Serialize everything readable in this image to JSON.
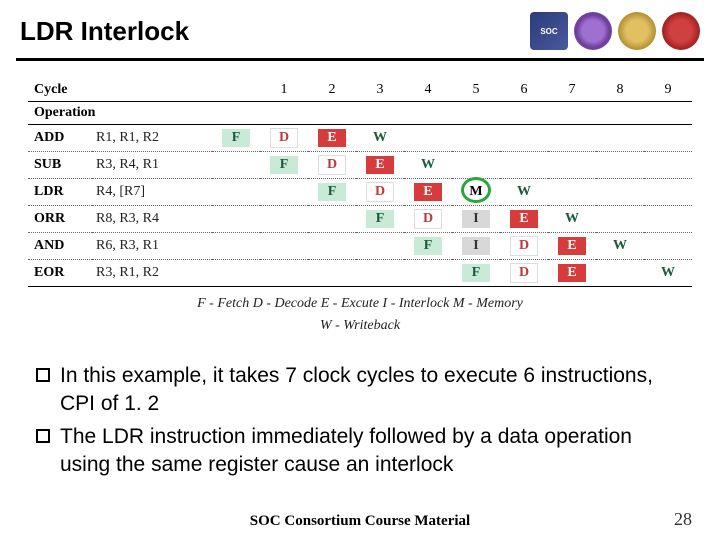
{
  "title": "LDR Interlock",
  "logos": [
    "SOC",
    "",
    "",
    ""
  ],
  "chart_data": {
    "type": "table",
    "title": "Pipeline cycle diagram",
    "header_label_1": "Cycle",
    "header_label_2": "Operation",
    "cycle_columns": [
      "",
      "1",
      "2",
      "3",
      "4",
      "5",
      "6",
      "7",
      "8",
      "9"
    ],
    "rows": [
      {
        "instr": "ADD",
        "operands": "R1, R1, R2",
        "stages": [
          "F",
          "D",
          "E",
          "W",
          "",
          "",
          "",
          "",
          "",
          ""
        ]
      },
      {
        "instr": "SUB",
        "operands": "R3, R4, R1",
        "stages": [
          "",
          "F",
          "D",
          "E",
          "W",
          "",
          "",
          "",
          "",
          ""
        ]
      },
      {
        "instr": "LDR",
        "operands": "R4, [R7]",
        "stages": [
          "",
          "",
          "F",
          "D",
          "E",
          "M",
          "W",
          "",
          "",
          ""
        ],
        "circle_col": 5
      },
      {
        "instr": "ORR",
        "operands": "R8, R3, R4",
        "stages": [
          "",
          "",
          "",
          "F",
          "D",
          "I",
          "E",
          "W",
          "",
          ""
        ]
      },
      {
        "instr": "AND",
        "operands": "R6, R3, R1",
        "stages": [
          "",
          "",
          "",
          "",
          "F",
          "I",
          "D",
          "E",
          "W",
          ""
        ]
      },
      {
        "instr": "EOR",
        "operands": "R3, R1, R2",
        "stages": [
          "",
          "",
          "",
          "",
          "",
          "F",
          "D",
          "E",
          "",
          "W"
        ]
      }
    ],
    "legend_line1": "F - Fetch        D - Decode        E - Excute        I - Interlock        M - Memory",
    "legend_line2": "W - Writeback"
  },
  "bullets": [
    "In this example, it takes 7 clock cycles to execute 6 instructions, CPI of 1. 2",
    "The LDR instruction immediately followed by a data operation using the same register cause an interlock"
  ],
  "footer": "SOC Consortium Course Material",
  "page_number": "28"
}
